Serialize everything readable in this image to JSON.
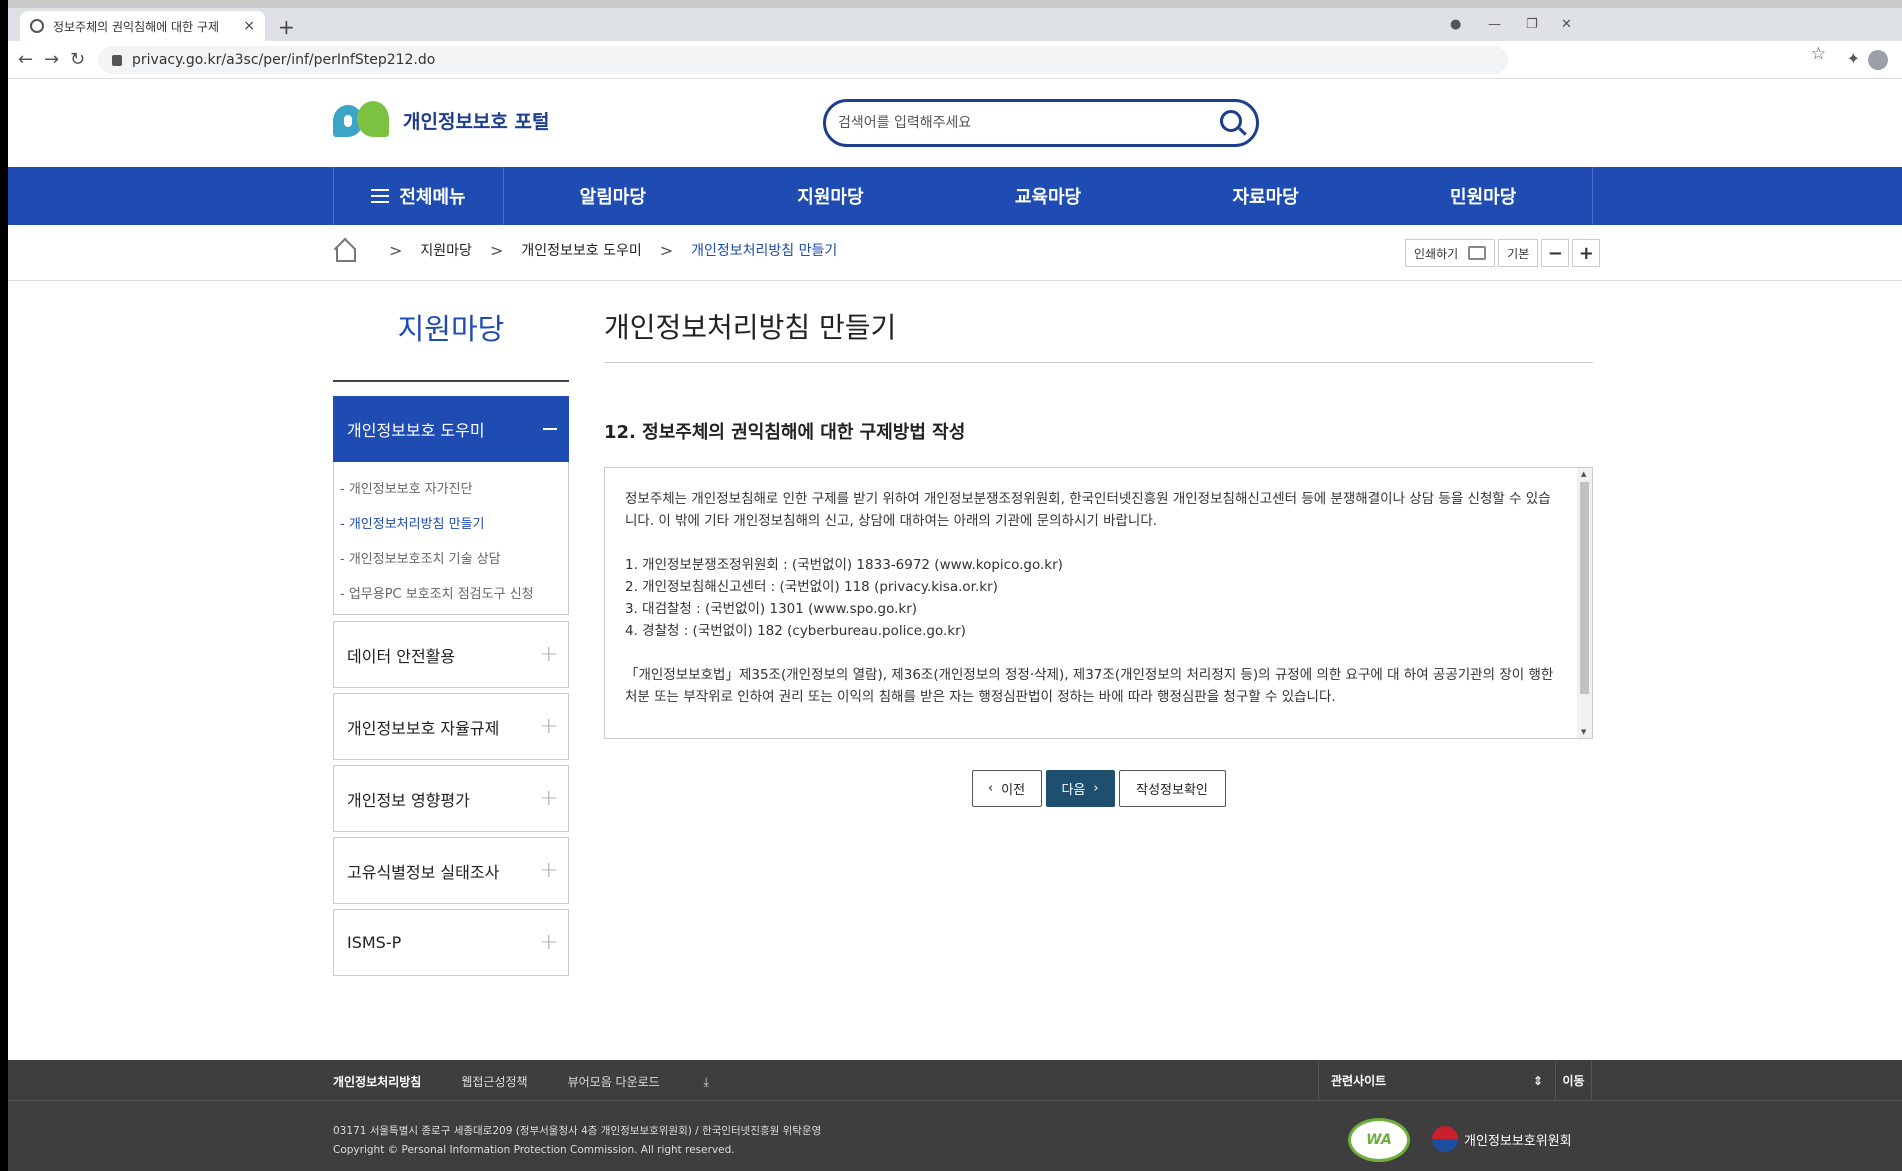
{
  "browser": {
    "tab_title": "정보주체의 권익침해에 대한 구제",
    "tab_close": "×",
    "new_tab": "+",
    "url": "privacy.go.kr/a3sc/per/inf/perInfStep212.do"
  },
  "header": {
    "logo_text": "개인정보보호 포털",
    "search_placeholder": "검색어를 입력해주세요"
  },
  "gnb": {
    "all_menu": "전체메뉴",
    "items": [
      "알림마당",
      "지원마당",
      "교육마당",
      "자료마당",
      "민원마당"
    ]
  },
  "breadcrumb": {
    "items": [
      "지원마당",
      "개인정보보호 도우미",
      "개인정보처리방침 만들기"
    ],
    "sep": ">",
    "print": "인쇄하기",
    "default": "기본",
    "minus": "−",
    "plus": "+"
  },
  "lnb": {
    "title": "지원마당",
    "open_section": "개인정보보호 도우미",
    "sub_items": [
      "- 개인정보보호 자가진단",
      "- 개인정보처리방침 만들기",
      "- 개인정보보호조치 기술 상담",
      "- 업무용PC 보호조치 점검도구 신청"
    ],
    "closed_sections": [
      "데이터 안전활용",
      "개인정보보호 자율규제",
      "개인정보 영향평가",
      "고유식별정보 실태조사",
      "ISMS-P"
    ]
  },
  "content": {
    "page_title": "개인정보처리방침 만들기",
    "section_title": "12. 정보주체의 권익침해에 대한 구제방법 작성",
    "para1": "정보주체는 개인정보침해로 인한 구제를 받기 위하여 개인정보분쟁조정위원회, 한국인터넷진흥원 개인정보침해신고센터 등에 분쟁해결이나 상담 등을 신청할 수 있습니다. 이 밖에 기타 개인정보침해의 신고, 상담에 대하여는 아래의 기관에 문의하시기 바랍니다.",
    "list": [
      "1. 개인정보분쟁조정위원회 : (국번없이) 1833-6972 (www.kopico.go.kr)",
      "2. 개인정보침해신고센터 : (국번없이) 118 (privacy.kisa.or.kr)",
      "3. 대검찰청 : (국번없이) 1301 (www.spo.go.kr)",
      "4. 경찰청 : (국번없이) 182 (cyberbureau.police.go.kr)"
    ],
    "para2": "「개인정보보호법」제35조(개인정보의 열람), 제36조(개인정보의 정정·삭제), 제37조(개인정보의 처리정지 등)의 규정에 의한 요구에 대 하여 공공기관의 장이 행한 처분 또는 부작위로 인하여 권리 또는 이익의 침해를 받은 자는 행정심판법이 정하는 바에 따라 행정심판을 청구할 수 있습니다.",
    "btn_prev": "이전",
    "btn_next": "다음",
    "btn_check": "작성정보확인"
  },
  "footer": {
    "links": [
      "개인정보처리방침",
      "웹접근성정책",
      "뷰어모음 다운로드"
    ],
    "related": "관련사이트",
    "go": "이동",
    "address": "03171 서울특별시 종로구 세종대로209 (정부서울청사 4층 개인정보보호위원회) / 한국인터넷진흥원 위탁운영",
    "copyright": "Copyright © Personal Information Protection Commission. All right reserved.",
    "wa_mark": "WA",
    "org_name": "개인정보보호위원회"
  }
}
